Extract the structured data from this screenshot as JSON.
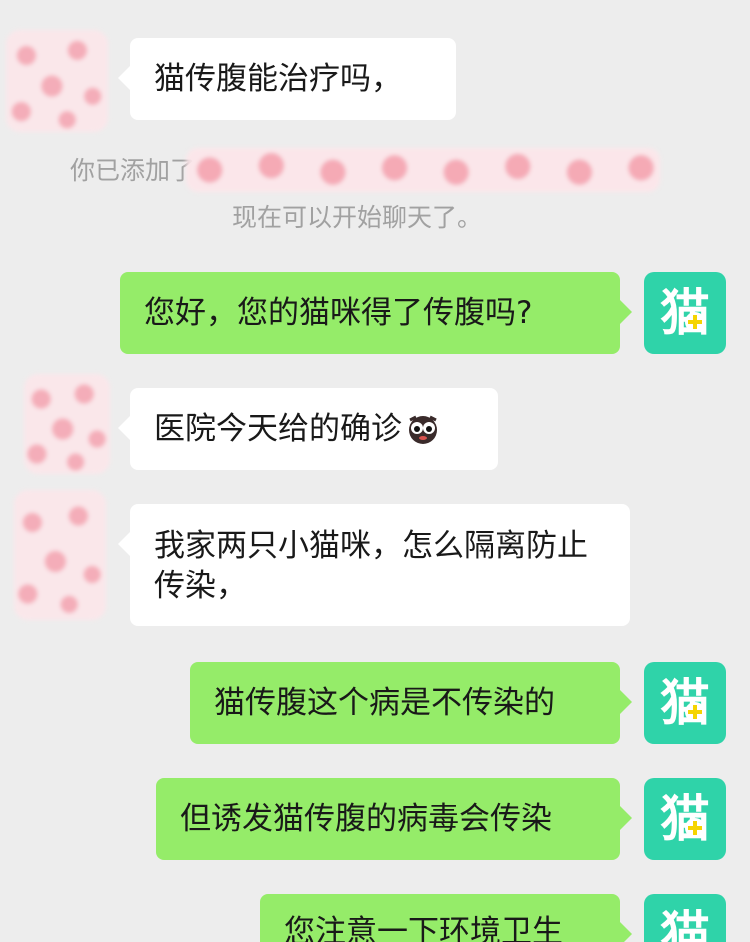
{
  "messages": [
    {
      "side": "in",
      "text": "猫传腹能治疗吗，"
    },
    {
      "side": "system",
      "line1": "你已添加了",
      "line2": "现在可以开始聊天了。"
    },
    {
      "side": "out",
      "text": "您好，您的猫咪得了传腹吗?"
    },
    {
      "side": "in",
      "text": "医院今天给的确诊",
      "emoji": "crying-face-emoji"
    },
    {
      "side": "in",
      "text": "我家两只小猫咪，怎么隔离防止传染，"
    },
    {
      "side": "out",
      "text": "猫传腹这个病是不传染的"
    },
    {
      "side": "out",
      "text": "但诱发猫传腹的病毒会传染"
    },
    {
      "side": "out",
      "text": "您注意一下环境卫生"
    }
  ],
  "avatars": {
    "contact": "blurred-heart-pattern",
    "self_icon": "cat-plus-icon",
    "self_glyph": "猫"
  },
  "colors": {
    "background": "#ededed",
    "incoming_bubble": "#ffffff",
    "outgoing_bubble": "#95ec69",
    "avatar_teal": "#2fd3a9",
    "system_text": "#a1a1a1"
  }
}
